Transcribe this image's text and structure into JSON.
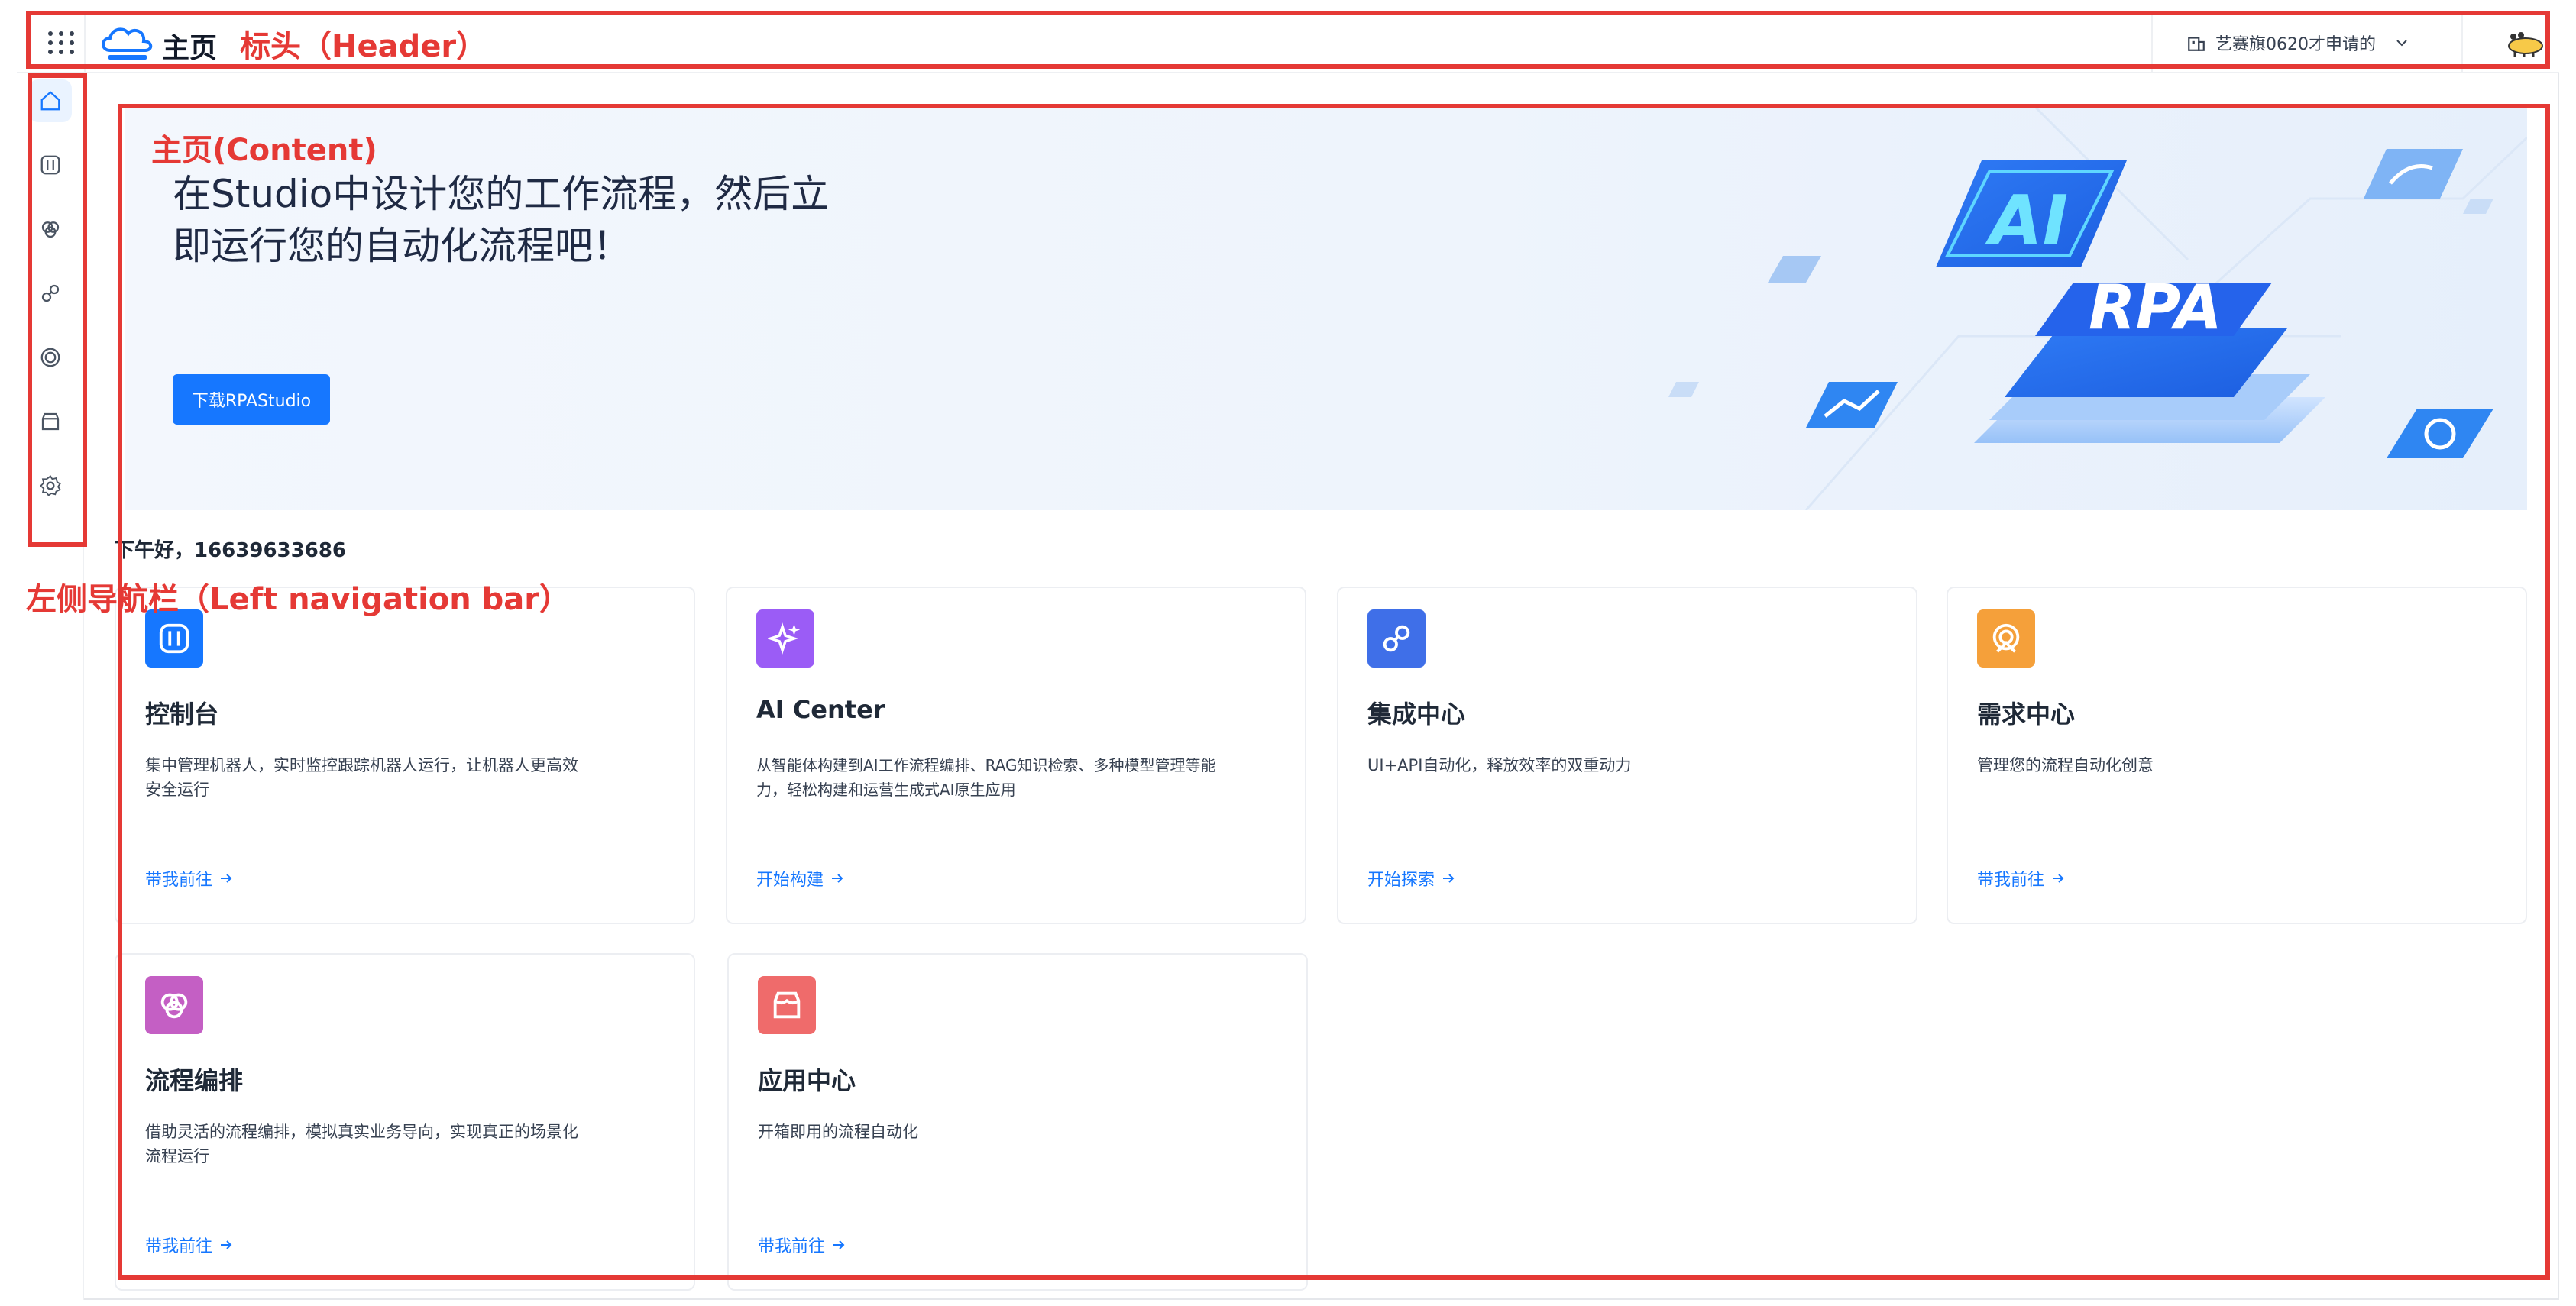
{
  "header": {
    "title": "主页",
    "workspace": "艺赛旗0620才申请的"
  },
  "annotations": {
    "header": "标头（Header）",
    "content": "主页(Content)",
    "sidebar": "左侧导航栏（Left navigation bar）"
  },
  "sidebar": {
    "items": [
      {
        "icon": "home-icon",
        "active": true
      },
      {
        "icon": "console-icon",
        "active": false
      },
      {
        "icon": "workflow-icon",
        "active": false
      },
      {
        "icon": "integration-icon",
        "active": false
      },
      {
        "icon": "demand-icon",
        "active": false
      },
      {
        "icon": "store-icon",
        "active": false
      },
      {
        "icon": "settings-icon",
        "active": false
      }
    ]
  },
  "banner": {
    "title": "在Studio中设计您的工作流程，然后立即运行您的自动化流程吧！",
    "button": "下载RPAStudio",
    "art_ai": "AI",
    "art_rpa": "RPA"
  },
  "greeting": "下午好，16639633686",
  "cards": [
    {
      "title": "控制台",
      "desc": "集中管理机器人，实时监控跟踪机器人运行，让机器人更高效安全运行",
      "link": "带我前往",
      "color": "#1677ff",
      "icon": "console-icon"
    },
    {
      "title": "AI Center",
      "desc": "从智能体构建到AI工作流程编排、RAG知识检索、多种模型管理等能力，轻松构建和运营生成式AI原生应用",
      "link": "开始构建",
      "color": "#9b5cf6",
      "icon": "sparkle-icon"
    },
    {
      "title": "集成中心",
      "desc": "UI+API自动化，释放效率的双重动力",
      "link": "开始探索",
      "color": "#3f6fe8",
      "icon": "integration-icon"
    },
    {
      "title": "需求中心",
      "desc": "管理您的流程自动化创意",
      "link": "带我前往",
      "color": "#f5a03a",
      "icon": "demand-icon"
    },
    {
      "title": "流程编排",
      "desc": "借助灵活的流程编排，模拟真实业务导向，实现真正的场景化流程运行",
      "link": "带我前往",
      "color": "#c45fc4",
      "icon": "workflow-icon"
    },
    {
      "title": "应用中心",
      "desc": "开箱即用的流程自动化",
      "link": "带我前往",
      "color": "#ef6b6b",
      "icon": "store-icon"
    }
  ]
}
